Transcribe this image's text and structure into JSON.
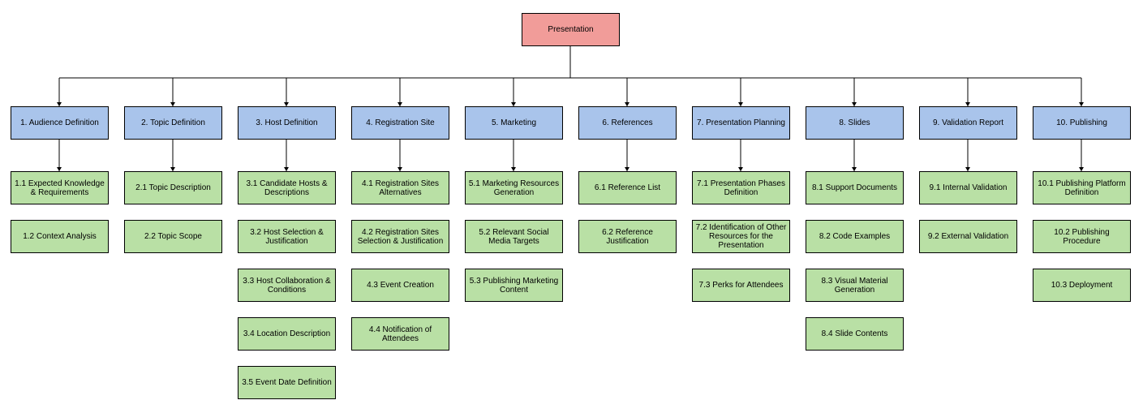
{
  "colors": {
    "root_fill": "#f19c99",
    "category_fill": "#a9c4eb",
    "task_fill": "#b9e0a5",
    "stroke": "#000000"
  },
  "root": {
    "label": "Presentation"
  },
  "categories": [
    {
      "label": "1. Audience Definition",
      "children": [
        "1.1 Expected Knowledge & Requirements",
        "1.2 Context Analysis"
      ]
    },
    {
      "label": "2. Topic Definition",
      "children": [
        "2.1 Topic Description",
        "2.2 Topic Scope"
      ]
    },
    {
      "label": "3. Host Definition",
      "children": [
        "3.1 Candidate Hosts & Descriptions",
        "3.2 Host Selection & Justification",
        "3.3 Host Collaboration & Conditions",
        "3.4 Location Description",
        "3.5 Event Date Definition"
      ]
    },
    {
      "label": "4. Registration Site",
      "children": [
        "4.1 Registration Sites Alternatives",
        "4.2 Registration Sites Selection & Justification",
        "4.3 Event Creation",
        "4.4 Notification of Attendees"
      ]
    },
    {
      "label": "5. Marketing",
      "children": [
        "5.1 Marketing Resources Generation",
        "5.2 Relevant Social Media Targets",
        "5.3 Publishing Marketing Content"
      ]
    },
    {
      "label": "6. References",
      "children": [
        "6.1 Reference List",
        "6.2 Reference Justification"
      ]
    },
    {
      "label": "7. Presentation Planning",
      "children": [
        "7.1 Presentation Phases Definition",
        "7.2 Identification of Other Resources for the Presentation",
        "7.3 Perks for Attendees"
      ]
    },
    {
      "label": "8. Slides",
      "children": [
        "8.1 Support Documents",
        "8.2 Code Examples",
        "8.3 Visual Material Generation",
        "8.4 Slide Contents"
      ]
    },
    {
      "label": "9. Validation Report",
      "children": [
        "9.1 Internal Validation",
        "9.2 External Validation"
      ]
    },
    {
      "label": "10. Publishing",
      "children": [
        "10.1 Publishing Platform Definition",
        "10.2 Publishing Procedure",
        "10.3 Deployment"
      ]
    }
  ]
}
